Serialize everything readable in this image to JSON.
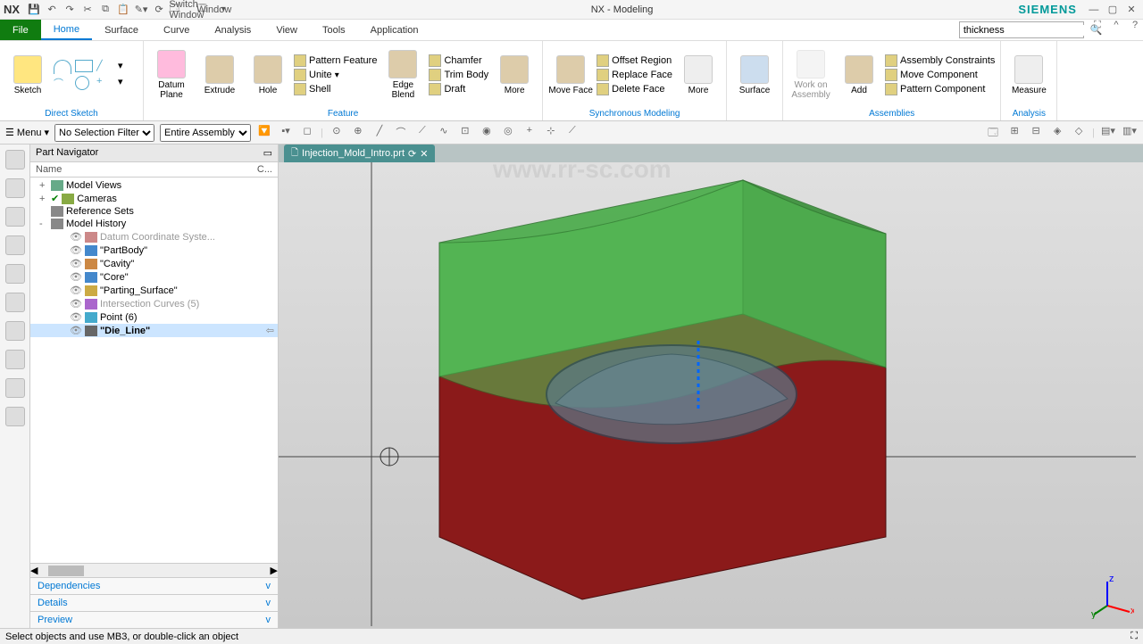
{
  "titlebar": {
    "logo": "NX",
    "title": "NX - Modeling",
    "brand": "SIEMENS",
    "switch_window": "Switch Window",
    "window": "Window"
  },
  "menu": {
    "file": "File",
    "tabs": [
      "Home",
      "Surface",
      "Curve",
      "Analysis",
      "View",
      "Tools",
      "Application"
    ],
    "active": "Home"
  },
  "search": {
    "value": "thickness"
  },
  "ribbon": {
    "direct_sketch": {
      "label": "Direct Sketch",
      "sketch": "Sketch"
    },
    "feature": {
      "label": "Feature",
      "datum": "Datum\nPlane",
      "extrude": "Extrude",
      "hole": "Hole",
      "pattern": "Pattern Feature",
      "unite": "Unite",
      "shell": "Shell",
      "edge_blend": "Edge\nBlend",
      "chamfer": "Chamfer",
      "trim": "Trim Body",
      "draft": "Draft",
      "more": "More"
    },
    "sync": {
      "label": "Synchronous Modeling",
      "move_face": "Move\nFace",
      "offset": "Offset Region",
      "replace": "Replace Face",
      "delete": "Delete Face",
      "more": "More"
    },
    "surface": {
      "label": "",
      "surface": "Surface"
    },
    "assemblies": {
      "label": "Assemblies",
      "work_on": "Work on\nAssembly",
      "add": "Add",
      "constraints": "Assembly Constraints",
      "move_comp": "Move Component",
      "pattern_comp": "Pattern Component"
    },
    "analysis": {
      "label": "Analysis",
      "measure": "Measure"
    }
  },
  "filter": {
    "menu": "Menu",
    "sel_filter": "No Selection Filter",
    "assembly": "Entire Assembly"
  },
  "navigator": {
    "title": "Part Navigator",
    "col_name": "Name",
    "col_c": "C...",
    "nodes": [
      {
        "t": "Model Views",
        "exp": "+",
        "ic": "#6a8"
      },
      {
        "t": "Cameras",
        "exp": "+",
        "ic": "#8a4",
        "chk": true
      },
      {
        "t": "Reference Sets",
        "exp": "",
        "ic": "#888"
      },
      {
        "t": "Model History",
        "exp": "-",
        "ic": "#888"
      }
    ],
    "history": [
      {
        "t": "Datum Coordinate Syste...",
        "ic": "#c88",
        "dim": true
      },
      {
        "t": "\"PartBody\"",
        "ic": "#48c"
      },
      {
        "t": "\"Cavity\"",
        "ic": "#c84"
      },
      {
        "t": "\"Core\"",
        "ic": "#48c"
      },
      {
        "t": "\"Parting_Surface\"",
        "ic": "#ca4"
      },
      {
        "t": "Intersection Curves (5)",
        "ic": "#a6c",
        "dim": true
      },
      {
        "t": "Point (6)",
        "ic": "#4ac"
      },
      {
        "t": "\"Die_Line\"",
        "ic": "#666",
        "sel": true,
        "bold": true
      }
    ],
    "dependencies": "Dependencies",
    "details": "Details",
    "preview": "Preview"
  },
  "file_tab": "Injection_Mold_Intro.prt",
  "status": "Select objects and use MB3, or double-click an object",
  "watermark_url": "www.rr-sc.com"
}
